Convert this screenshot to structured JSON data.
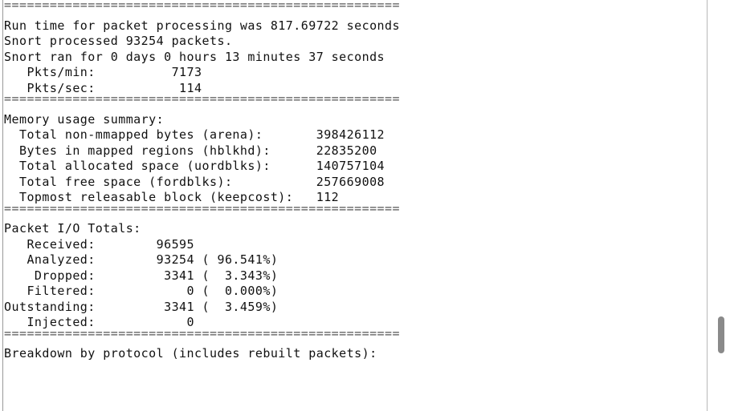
{
  "separator": "==============================================================================",
  "runtime": {
    "line1": "Run time for packet processing was 817.69722 seconds",
    "line2": "Snort processed 93254 packets.",
    "line3": "Snort ran for 0 days 0 hours 13 minutes 37 seconds",
    "pkts_min": "   Pkts/min:          7173",
    "pkts_sec": "   Pkts/sec:           114"
  },
  "memory": {
    "header": "Memory usage summary:",
    "rows": [
      "  Total non-mmapped bytes (arena):       398426112",
      "  Bytes in mapped regions (hblkhd):      22835200",
      "  Total allocated space (uordblks):      140757104",
      "  Total free space (fordblks):           257669008",
      "  Topmost releasable block (keepcost):   112"
    ]
  },
  "packet_io": {
    "header": "Packet I/O Totals:",
    "rows": [
      "   Received:        96595",
      "   Analyzed:        93254 ( 96.541%)",
      "    Dropped:         3341 (  3.343%)",
      "   Filtered:            0 (  0.000%)",
      "Outstanding:         3341 (  3.459%)",
      "   Injected:            0"
    ]
  },
  "breakdown": {
    "header": "Breakdown by protocol (includes rebuilt packets):"
  }
}
